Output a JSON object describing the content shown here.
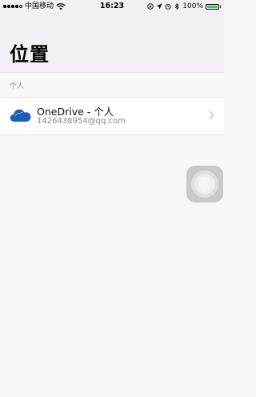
{
  "status_bar": {
    "carrier": "中国移动",
    "time": "16:23",
    "battery_percent": "100%",
    "battery_level": 1.0,
    "battery_color": "#3cc84a"
  },
  "header": {
    "title": "位置"
  },
  "section": {
    "label": "个人"
  },
  "locations": [
    {
      "title": "OneDrive - 个人",
      "subtitle": "1426438954@qq.com",
      "icon": "onedrive-cloud-icon"
    }
  ],
  "colors": {
    "onedrive_blue": "#1a5fb4",
    "header_bg": "#f4eff4"
  }
}
